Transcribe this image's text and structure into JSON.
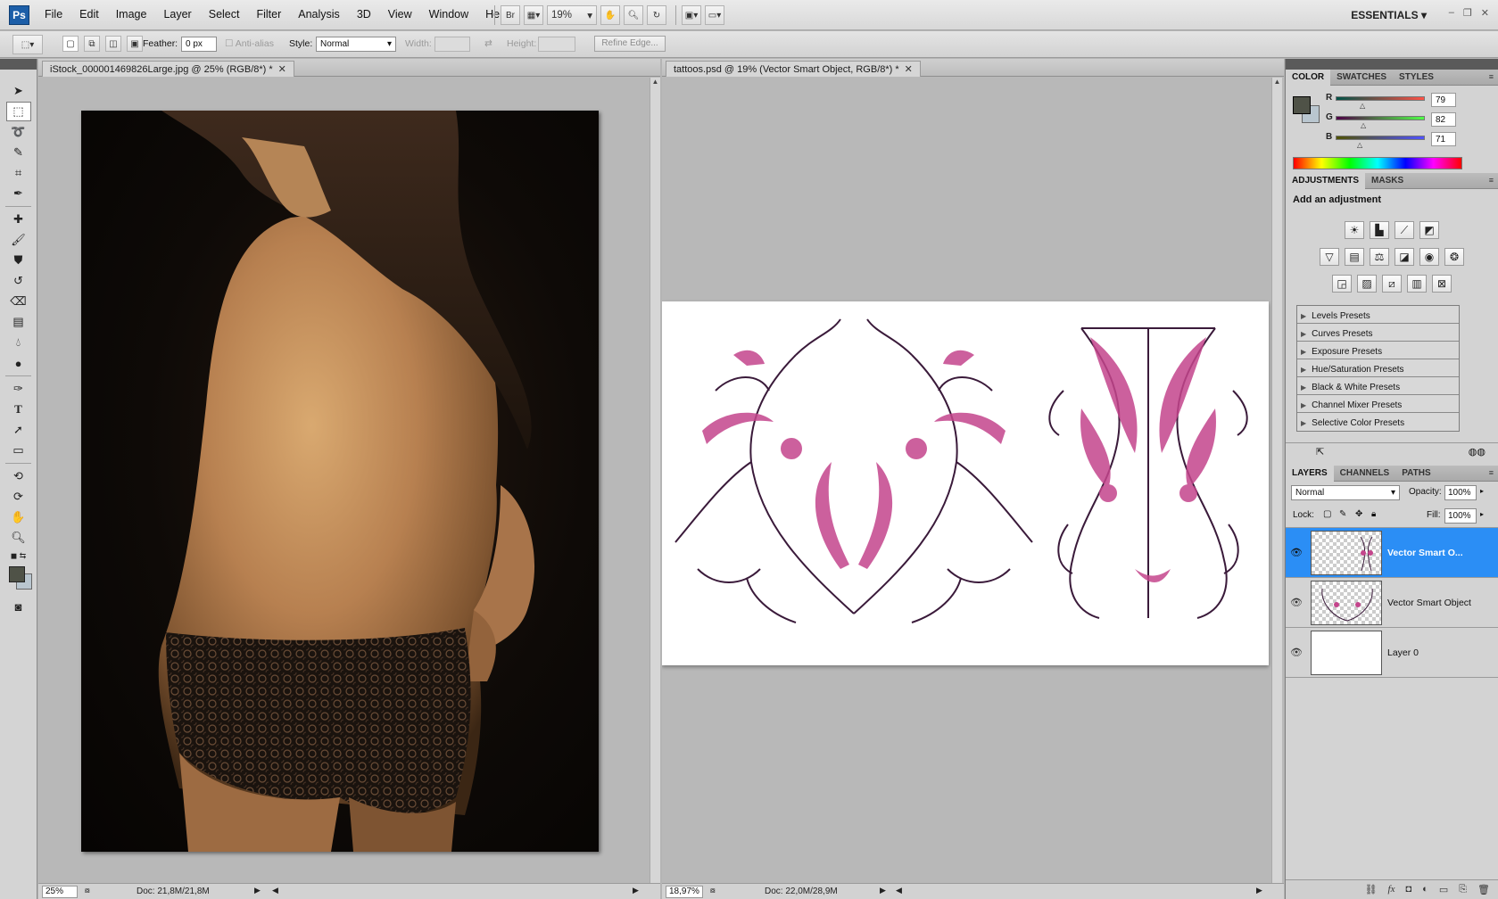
{
  "app": {
    "logo": "Ps",
    "menu": [
      "File",
      "Edit",
      "Image",
      "Layer",
      "Select",
      "Filter",
      "Analysis",
      "3D",
      "View",
      "Window",
      "Help"
    ],
    "bridge_label": "Br",
    "zoom": "19%",
    "workspace": "ESSENTIALS",
    "window_controls": [
      "–",
      "❐",
      "✕"
    ]
  },
  "options": {
    "feather_label": "Feather:",
    "feather_value": "0 px",
    "antialias_label": "Anti-alias",
    "style_label": "Style:",
    "style_value": "Normal",
    "width_label": "Width:",
    "height_label": "Height:",
    "refine_edge": "Refine Edge..."
  },
  "documents": [
    {
      "title": "iStock_000001469826Large.jpg @ 25% (RGB/8*) *",
      "status_zoom": "25%",
      "status_doc": "Doc: 21,8M/21,8M"
    },
    {
      "title": "tattoos.psd @ 19% (Vector Smart Object, RGB/8*) *",
      "status_zoom": "18,97%",
      "status_doc": "Doc: 22,0M/28,9M"
    }
  ],
  "color_panel": {
    "tabs": [
      "COLOR",
      "SWATCHES",
      "STYLES"
    ],
    "channels": [
      {
        "label": "R",
        "value": "79",
        "fraction": 0.31
      },
      {
        "label": "G",
        "value": "82",
        "fraction": 0.32
      },
      {
        "label": "B",
        "value": "71",
        "fraction": 0.28
      }
    ],
    "foreground": "#4f5247",
    "background": "#b9c6cf"
  },
  "adjustments_panel": {
    "tabs": [
      "ADJUSTMENTS",
      "MASKS"
    ],
    "title": "Add an adjustment",
    "presets": [
      "Levels Presets",
      "Curves Presets",
      "Exposure Presets",
      "Hue/Saturation Presets",
      "Black & White Presets",
      "Channel Mixer Presets",
      "Selective Color Presets"
    ]
  },
  "layers_panel": {
    "tabs": [
      "LAYERS",
      "CHANNELS",
      "PATHS"
    ],
    "blend_mode": "Normal",
    "opacity_label": "Opacity:",
    "opacity": "100%",
    "lock_label": "Lock:",
    "fill_label": "Fill:",
    "fill": "100%",
    "layers": [
      {
        "name": "Vector Smart O...",
        "selected": true
      },
      {
        "name": "Vector Smart Object",
        "selected": false
      },
      {
        "name": "Layer 0",
        "selected": false
      }
    ]
  },
  "colors": {
    "selection": "#2b8ef5",
    "tattoo_pink": "#c4458c",
    "tattoo_ink": "#3a1a3a"
  }
}
